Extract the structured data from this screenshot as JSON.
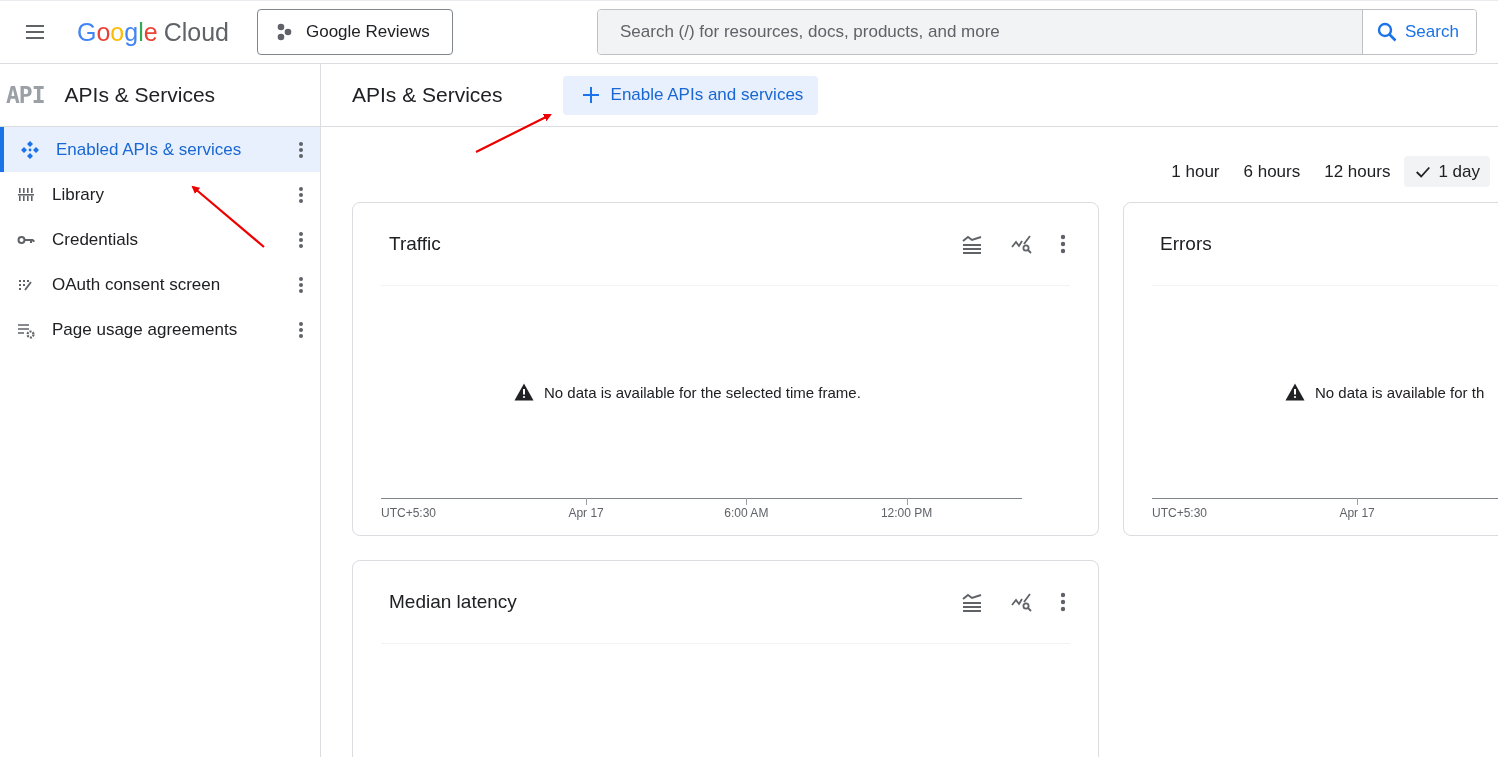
{
  "top_bar": {
    "brand": {
      "word": "Google",
      "product": "Cloud"
    },
    "project": "Google Reviews",
    "search": {
      "placeholder": "Search (/) for resources, docs, products, and more",
      "button": "Search"
    }
  },
  "sidebar": {
    "badge": "API",
    "title": "APIs & Services",
    "items": [
      {
        "kind": "enabled",
        "label": "Enabled APIs & services",
        "selected": true
      },
      {
        "kind": "library",
        "label": "Library",
        "selected": false
      },
      {
        "kind": "key",
        "label": "Credentials",
        "selected": false
      },
      {
        "kind": "consent",
        "label": "OAuth consent screen",
        "selected": false
      },
      {
        "kind": "agreements",
        "label": "Page usage agreements",
        "selected": false
      }
    ]
  },
  "main": {
    "title": "APIs & Services",
    "enable_button": "Enable APIs and services",
    "time_ranges": [
      {
        "label": "1 hour",
        "selected": false
      },
      {
        "label": "6 hours",
        "selected": false
      },
      {
        "label": "12 hours",
        "selected": false
      },
      {
        "label": "1 day",
        "selected": true
      }
    ],
    "cards": [
      {
        "title": "Traffic",
        "toolbar": true,
        "message": "No data is available for the selected time frame.",
        "x_labels": [
          "UTC+5:30",
          "Apr 17",
          "6:00 AM",
          "12:00 PM"
        ]
      },
      {
        "title": "Errors",
        "message": "No data is available for th",
        "x_labels": [
          "UTC+5:30",
          "Apr 17"
        ]
      },
      {
        "title": "Median latency",
        "toolbar": true
      }
    ]
  }
}
